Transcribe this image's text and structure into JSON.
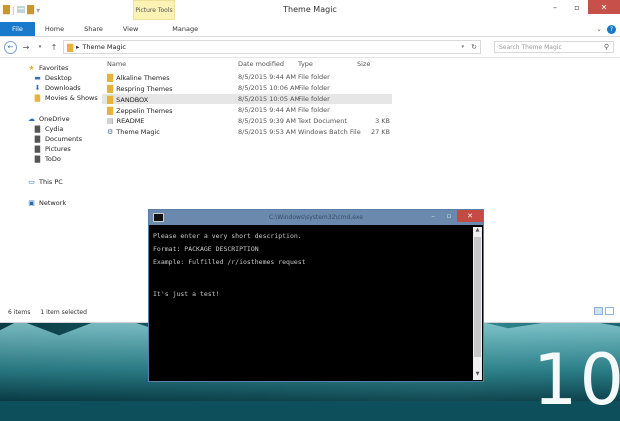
{
  "explorer": {
    "title": "Theme Magic",
    "contextual_tab": "Picture Tools",
    "ribbon_tabs": [
      "File",
      "Home",
      "Share",
      "View",
      "Manage"
    ],
    "address_path": [
      "Theme Magic"
    ],
    "search_placeholder": "Search Theme Magic",
    "nav": {
      "favorites_label": "Favorites",
      "favorites": [
        "Desktop",
        "Downloads",
        "Movies & Shows"
      ],
      "onedrive_label": "OneDrive",
      "onedrive": [
        "Cydia",
        "Documents",
        "Pictures",
        "ToDo"
      ],
      "thispc_label": "This PC",
      "network_label": "Network"
    },
    "columns": {
      "name": "Name",
      "date": "Date modified",
      "type": "Type",
      "size": "Size"
    },
    "files": [
      {
        "name": "Alkaline Themes",
        "date": "8/5/2015 9:44 AM",
        "type": "File folder",
        "size": "",
        "icon": "folder-icon"
      },
      {
        "name": "Respring Themes",
        "date": "8/5/2015 10:06 AM",
        "type": "File folder",
        "size": "",
        "icon": "folder-icon"
      },
      {
        "name": "SANDBOX",
        "date": "8/5/2015 10:05 AM",
        "type": "File folder",
        "size": "",
        "icon": "folder-icon"
      },
      {
        "name": "Zeppelin Themes",
        "date": "8/5/2015 9:44 AM",
        "type": "File folder",
        "size": "",
        "icon": "folder-icon"
      },
      {
        "name": "README",
        "date": "8/5/2015 9:39 AM",
        "type": "Text Document",
        "size": "3 KB",
        "icon": "text-file-icon"
      },
      {
        "name": "Theme Magic",
        "date": "8/5/2015 9:53 AM",
        "type": "Windows Batch File",
        "size": "27 KB",
        "icon": "batch-file-icon"
      }
    ],
    "status": {
      "items": "6 items",
      "selected": "1 item selected"
    }
  },
  "cmd": {
    "title": "C:\\Windows\\system32\\cmd.exe",
    "lines": [
      "Please enter a very short description.",
      "Format: PACKAGE DESCRIPTION",
      "Example: Fulfilled /r/iosthemes request",
      "",
      "It's just a test!"
    ]
  },
  "desktop": {
    "corner_text": "10"
  },
  "colors": {
    "accent": "#1979ca",
    "picture_tools": "#fbf2b3",
    "close": "#c7504a"
  }
}
